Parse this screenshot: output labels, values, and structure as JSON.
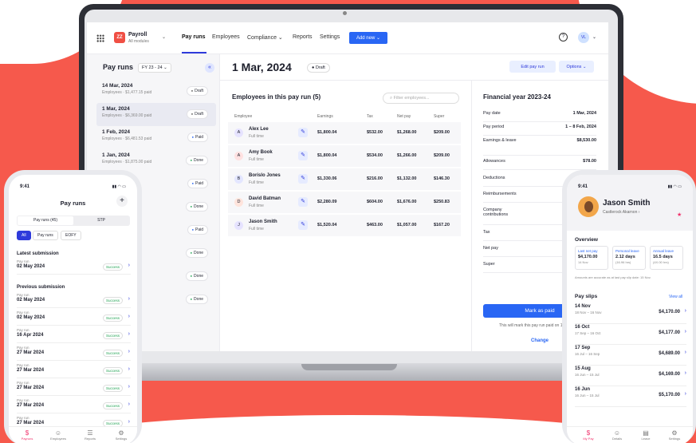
{
  "app": {
    "brand": "Payroll",
    "brand_sub": "All modules",
    "logo_text": "ZZ",
    "nav": [
      "Pay runs",
      "Employees",
      "Compliance ⌄",
      "Reports",
      "Settings"
    ],
    "add_new": "Add new ⌄",
    "user_initials": "VL",
    "colors": {
      "primary": "#2966f4",
      "background": "#f6594c",
      "success": "#23a455"
    }
  },
  "payruns": {
    "title": "Pay runs",
    "fy": "FY 23 - 24 ⌄",
    "items": [
      {
        "date": "14 Mar, 2024",
        "sub": "Employees · $1,477.15 paid",
        "status": "Draft"
      },
      {
        "date": "1 Mar, 2024",
        "sub": "Employees · $6,369.00 paid",
        "status": "Draft"
      },
      {
        "date": "1 Feb, 2024",
        "sub": "Employees · $6,481.53 paid",
        "status": "Paid"
      },
      {
        "date": "1 Jan, 2024",
        "sub": "Employees · $1,875.00 paid",
        "status": "Done"
      },
      {
        "date": "",
        "sub": "",
        "status": "Paid"
      },
      {
        "date": "",
        "sub": "",
        "status": "Done"
      },
      {
        "date": "",
        "sub": "",
        "status": "Paid"
      },
      {
        "date": "",
        "sub": "",
        "status": "Done"
      },
      {
        "date": "",
        "sub": "",
        "status": "Done"
      },
      {
        "date": "",
        "sub": "",
        "status": "Done"
      }
    ]
  },
  "main": {
    "title": "1 Mar, 2024",
    "status": "Draft",
    "edit": "Edit pay run",
    "options": "Options ⌄",
    "employees_title": "Employees in this pay run (5)",
    "filter_placeholder": "Filter employees...",
    "columns": [
      "Employee",
      "Earnings",
      "Tax",
      "Net pay",
      "Super"
    ],
    "employees": [
      {
        "initial": "A",
        "name": "Alex Lee",
        "type": "Full time",
        "earnings": "$1,800.04",
        "tax": "$532.00",
        "net": "$1,268.00",
        "super": "$209.00"
      },
      {
        "initial": "A",
        "name": "Amy Book",
        "type": "Full time",
        "earnings": "$1,800.04",
        "tax": "$534.00",
        "net": "$1,266.00",
        "super": "$209.00"
      },
      {
        "initial": "B",
        "name": "Borislo Jones",
        "type": "Full time",
        "earnings": "$1,330.06",
        "tax": "$216.00",
        "net": "$1,132.00",
        "super": "$146.30"
      },
      {
        "initial": "D",
        "name": "David Batman",
        "type": "Full time",
        "earnings": "$2,280.09",
        "tax": "$604.00",
        "net": "$1,676.00",
        "super": "$250.83"
      },
      {
        "initial": "J",
        "name": "Jason Smith",
        "type": "Full time",
        "earnings": "$1,520.04",
        "tax": "$463.00",
        "net": "$1,057.00",
        "super": "$167.20"
      }
    ]
  },
  "finance": {
    "title": "Financial year 2023-24",
    "rows": [
      {
        "label": "Pay date",
        "value": "1 Mar, 2024"
      },
      {
        "label": "Pay period",
        "value": "1 – 8 Feb, 2024"
      },
      {
        "label": "Earnings & leave",
        "value": "$8,530.00"
      },
      {
        "label": "Allowances",
        "value": "$78.00"
      },
      {
        "label": "Deductions",
        "value": ""
      },
      {
        "label": "Reimbursements",
        "value": ""
      },
      {
        "label": "Company contributions",
        "value": ""
      },
      {
        "label": "Tax",
        "value": ""
      },
      {
        "label": "Net pay",
        "value": ""
      },
      {
        "label": "Super",
        "value": ""
      }
    ],
    "mark_paid": "Mark as paid",
    "note": "This will mark this pay run paid on 1 Mar 2024",
    "change": "Change"
  },
  "phone_left": {
    "time": "9:41",
    "title": "Pay runs",
    "plus": "+",
    "seg": [
      "Pay runs (45)",
      "STP"
    ],
    "chips": [
      "All",
      "Pay runs",
      "EOFY"
    ],
    "latest_title": "Latest submission",
    "previous_title": "Previous submission",
    "row_label": "Pay run",
    "success": "Success",
    "latest": [
      "02 May 2024"
    ],
    "previous": [
      "02 May 2024",
      "02 May 2024",
      "16 Apr 2024",
      "27 Mar 2024",
      "27 Mar 2024",
      "27 Mar 2024",
      "27 Mar 2024",
      "27 Mar 2024"
    ],
    "tabs": [
      "Payruns",
      "Employees",
      "Reports",
      "Settings"
    ]
  },
  "phone_right": {
    "time": "9:41",
    "name": "Jason Smith",
    "sub": "Castlerock Akarnon ›",
    "overview": "Overview",
    "boxes": [
      {
        "title": "Last net pay",
        "value": "$4,170.00",
        "extra": "14 Nov"
      },
      {
        "title": "Personal leave",
        "value": "2.12 days",
        "extra": "(16.96 hrs)"
      },
      {
        "title": "Annual leave",
        "value": "16.5 days",
        "extra": "(4X.00 hrs)"
      }
    ],
    "note": "Amounts are accurate as at last pay slip date: 15 Nov.",
    "payslips": "Pay slips",
    "view_all": "View all",
    "slips": [
      {
        "date": "14 Nov",
        "range": "18 Nov – 16 Nov",
        "value": "$4,170.00"
      },
      {
        "date": "16 Oct",
        "range": "17 Sep – 16 Oct",
        "value": "$4,177.00"
      },
      {
        "date": "17 Sep",
        "range": "16 Jul – 16 Sep",
        "value": "$4,689.00"
      },
      {
        "date": "15 Aug",
        "range": "16 Jun – 15 Jul",
        "value": "$4,169.00"
      },
      {
        "date": "16 Jun",
        "range": "16 Jun – 15 Jul",
        "value": "$5,170.00"
      }
    ],
    "tabs": [
      "My Pay",
      "Details",
      "Leave",
      "Settings"
    ]
  }
}
